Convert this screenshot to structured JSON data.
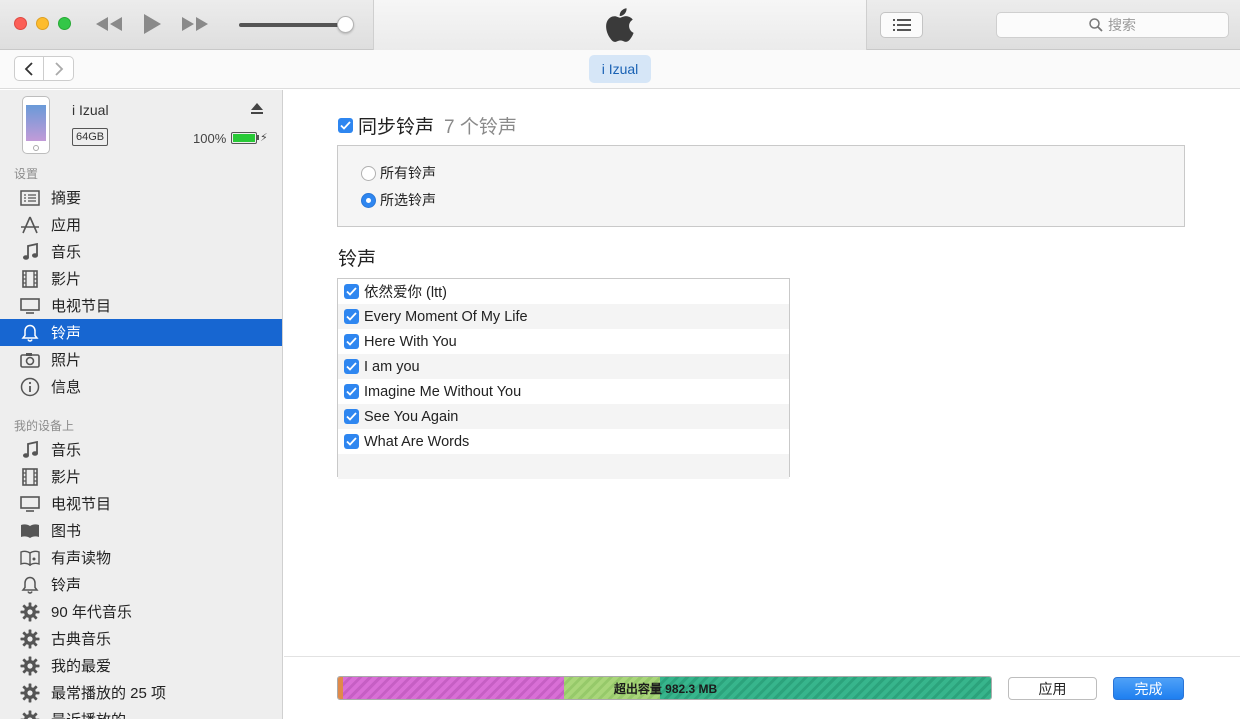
{
  "search": {
    "placeholder": "搜索"
  },
  "nav": {
    "device_tab": "i Izual"
  },
  "device": {
    "name": "i Izual",
    "capacity": "64GB",
    "battery_percent": "100%",
    "battery_level": 1.0
  },
  "sidebar": {
    "settings_header": "设置",
    "settings_items": [
      {
        "label": "摘要",
        "icon": "summary-icon"
      },
      {
        "label": "应用",
        "icon": "apps-icon"
      },
      {
        "label": "音乐",
        "icon": "music-note-icon"
      },
      {
        "label": "影片",
        "icon": "film-icon"
      },
      {
        "label": "电视节目",
        "icon": "tv-icon"
      },
      {
        "label": "铃声",
        "icon": "bell-icon",
        "active": true
      },
      {
        "label": "照片",
        "icon": "camera-icon"
      },
      {
        "label": "信息",
        "icon": "info-icon"
      }
    ],
    "device_header": "我的设备上",
    "device_items": [
      {
        "label": "音乐",
        "icon": "music-note-icon"
      },
      {
        "label": "影片",
        "icon": "film-icon"
      },
      {
        "label": "电视节目",
        "icon": "tv-icon"
      },
      {
        "label": "图书",
        "icon": "book-icon"
      },
      {
        "label": "有声读物",
        "icon": "audiobook-icon"
      },
      {
        "label": "铃声",
        "icon": "bell-icon"
      },
      {
        "label": "90 年代音乐",
        "icon": "gear-icon"
      },
      {
        "label": "古典音乐",
        "icon": "gear-icon"
      },
      {
        "label": "我的最爱",
        "icon": "gear-icon"
      },
      {
        "label": "最常播放的 25 项",
        "icon": "gear-icon"
      },
      {
        "label": "最近播放的",
        "icon": "gear-icon"
      }
    ]
  },
  "main": {
    "sync_label": "同步铃声",
    "sync_count": "7 个铃声",
    "sync_checked": true,
    "radio_all": "所有铃声",
    "radio_selected": "所选铃声",
    "selected_option": "selected",
    "list_heading": "铃声",
    "ringtones": [
      {
        "name": "依然爱你 (ltt)",
        "checked": true
      },
      {
        "name": "Every Moment Of My Life",
        "checked": true
      },
      {
        "name": "Here With You",
        "checked": true
      },
      {
        "name": "I am you",
        "checked": true
      },
      {
        "name": "Imagine Me Without You",
        "checked": true
      },
      {
        "name": "See You Again",
        "checked": true
      },
      {
        "name": "What Are Words",
        "checked": true
      }
    ]
  },
  "footer": {
    "capacity_text": "超出容量 982.3 MB",
    "apply_label": "应用",
    "done_label": "完成"
  },
  "colors": {
    "accent": "#1766d1",
    "checkbox": "#2e86f0",
    "storage_apps": "#d96fd6",
    "storage_other": "#a9d67a",
    "storage_music": "#37b58c"
  }
}
